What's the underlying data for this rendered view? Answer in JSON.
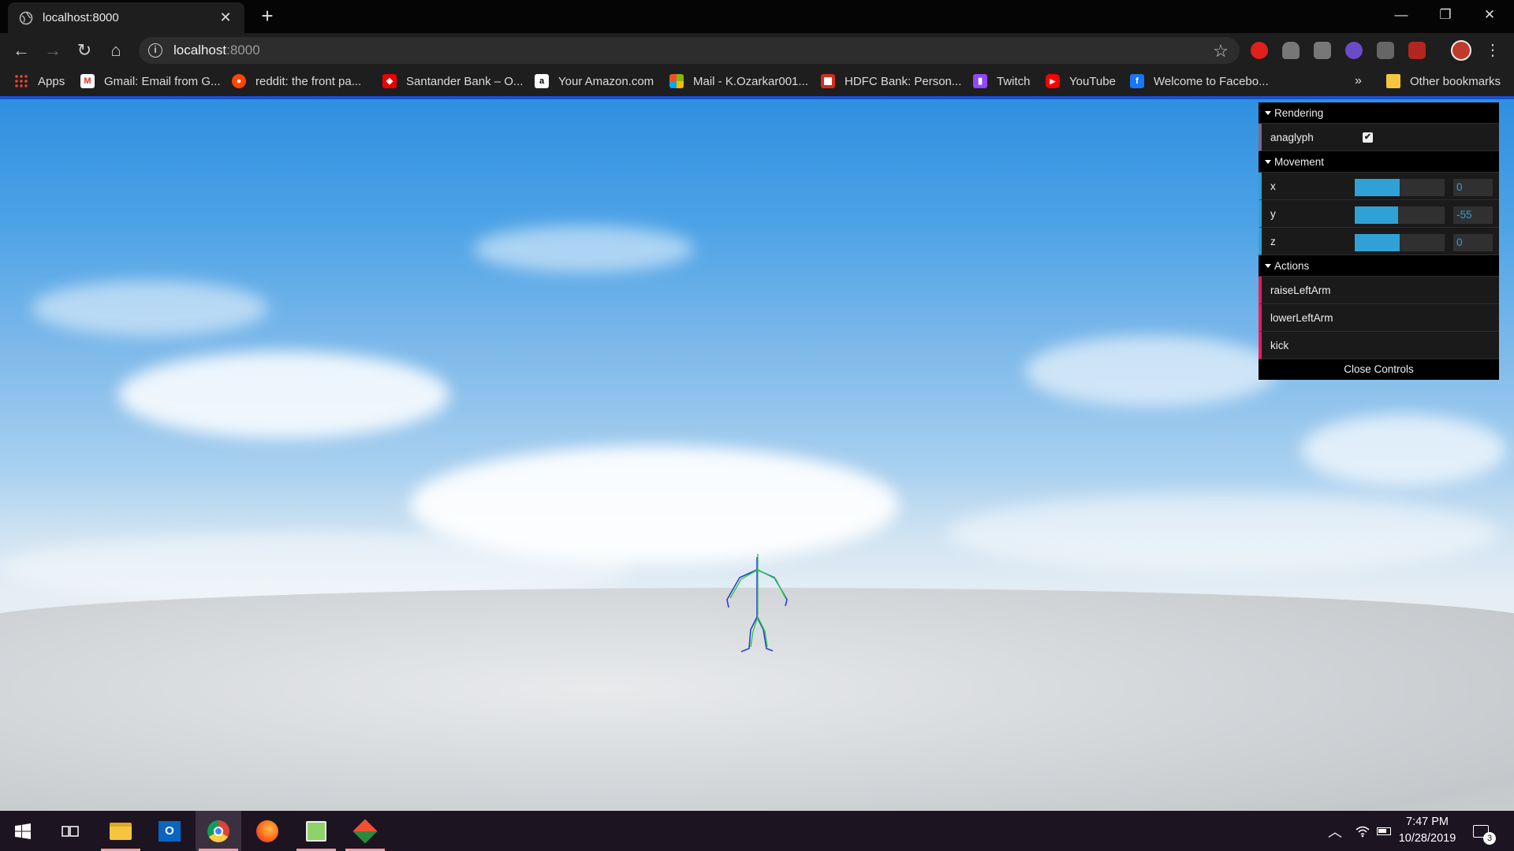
{
  "browser": {
    "tab_title": "localhost:8000",
    "tab_close": "✕",
    "new_tab": "+",
    "window_controls": {
      "minimize": "—",
      "restore": "❐",
      "close": "✕"
    },
    "nav": {
      "back": "←",
      "forward": "→",
      "reload": "↻",
      "home": "⌂"
    },
    "address": {
      "host": "localhost",
      "port": ":8000",
      "info": "i",
      "star": "☆"
    },
    "menu": "⋮"
  },
  "bookmarks": {
    "items": [
      {
        "label": "Apps",
        "icon": "apps-grid-icon",
        "color": "#e53935"
      },
      {
        "label": "Gmail: Email from G...",
        "icon": "gmail-icon",
        "color": "#d93025"
      },
      {
        "label": "reddit: the front pa...",
        "icon": "reddit-icon",
        "color": "#ff4500"
      },
      {
        "label": "Santander Bank – O...",
        "icon": "santander-icon",
        "color": "#ec0000"
      },
      {
        "label": "Your Amazon.com",
        "icon": "amazon-icon",
        "color": "#ffffff"
      },
      {
        "label": "Mail - K.Ozarkar001...",
        "icon": "microsoft-icon",
        "color": "#f25022"
      },
      {
        "label": "HDFC Bank: Person...",
        "icon": "hdfc-icon",
        "color": "#d52b1e"
      },
      {
        "label": "Twitch",
        "icon": "twitch-icon",
        "color": "#9146ff"
      },
      {
        "label": "YouTube",
        "icon": "youtube-icon",
        "color": "#ff0000"
      },
      {
        "label": "Welcome to Facebo...",
        "icon": "facebook-icon",
        "color": "#1877f2"
      }
    ],
    "overflow": "»",
    "other": "Other bookmarks"
  },
  "gui": {
    "rendering": {
      "title": "Rendering",
      "anaglyph_label": "anaglyph",
      "anaglyph_checked": true,
      "check_mark": "✔"
    },
    "movement": {
      "title": "Movement",
      "x": {
        "label": "x",
        "value": "0",
        "fill": 0.5
      },
      "y": {
        "label": "y",
        "value": "-55",
        "fill": 0.48
      },
      "z": {
        "label": "z",
        "value": "0",
        "fill": 0.5
      }
    },
    "actions": {
      "title": "Actions",
      "items": [
        "raiseLeftArm",
        "lowerLeftArm",
        "kick"
      ]
    },
    "close_label": "Close Controls"
  },
  "taskbar": {
    "clock_time": "7:47 PM",
    "clock_date": "10/28/2019",
    "notifications": "3",
    "apps": [
      "start-icon",
      "task-view-icon",
      "file-explorer-icon",
      "outlook-icon",
      "chrome-icon",
      "firefox-icon",
      "notepad-plus-icon",
      "git-icon"
    ]
  }
}
